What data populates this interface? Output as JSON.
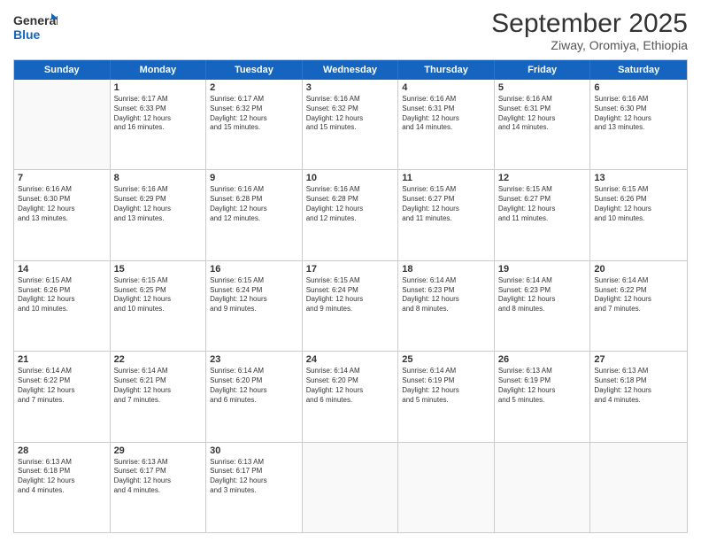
{
  "header": {
    "logo_line1": "General",
    "logo_line2": "Blue",
    "title": "September 2025",
    "subtitle": "Ziway, Oromiya, Ethiopia"
  },
  "calendar": {
    "headers": [
      "Sunday",
      "Monday",
      "Tuesday",
      "Wednesday",
      "Thursday",
      "Friday",
      "Saturday"
    ],
    "rows": [
      [
        {
          "day": "",
          "empty": true,
          "lines": []
        },
        {
          "day": "1",
          "lines": [
            "Sunrise: 6:17 AM",
            "Sunset: 6:33 PM",
            "Daylight: 12 hours",
            "and 16 minutes."
          ]
        },
        {
          "day": "2",
          "lines": [
            "Sunrise: 6:17 AM",
            "Sunset: 6:32 PM",
            "Daylight: 12 hours",
            "and 15 minutes."
          ]
        },
        {
          "day": "3",
          "lines": [
            "Sunrise: 6:16 AM",
            "Sunset: 6:32 PM",
            "Daylight: 12 hours",
            "and 15 minutes."
          ]
        },
        {
          "day": "4",
          "lines": [
            "Sunrise: 6:16 AM",
            "Sunset: 6:31 PM",
            "Daylight: 12 hours",
            "and 14 minutes."
          ]
        },
        {
          "day": "5",
          "lines": [
            "Sunrise: 6:16 AM",
            "Sunset: 6:31 PM",
            "Daylight: 12 hours",
            "and 14 minutes."
          ]
        },
        {
          "day": "6",
          "lines": [
            "Sunrise: 6:16 AM",
            "Sunset: 6:30 PM",
            "Daylight: 12 hours",
            "and 13 minutes."
          ]
        }
      ],
      [
        {
          "day": "7",
          "lines": [
            "Sunrise: 6:16 AM",
            "Sunset: 6:30 PM",
            "Daylight: 12 hours",
            "and 13 minutes."
          ]
        },
        {
          "day": "8",
          "lines": [
            "Sunrise: 6:16 AM",
            "Sunset: 6:29 PM",
            "Daylight: 12 hours",
            "and 13 minutes."
          ]
        },
        {
          "day": "9",
          "lines": [
            "Sunrise: 6:16 AM",
            "Sunset: 6:28 PM",
            "Daylight: 12 hours",
            "and 12 minutes."
          ]
        },
        {
          "day": "10",
          "lines": [
            "Sunrise: 6:16 AM",
            "Sunset: 6:28 PM",
            "Daylight: 12 hours",
            "and 12 minutes."
          ]
        },
        {
          "day": "11",
          "lines": [
            "Sunrise: 6:15 AM",
            "Sunset: 6:27 PM",
            "Daylight: 12 hours",
            "and 11 minutes."
          ]
        },
        {
          "day": "12",
          "lines": [
            "Sunrise: 6:15 AM",
            "Sunset: 6:27 PM",
            "Daylight: 12 hours",
            "and 11 minutes."
          ]
        },
        {
          "day": "13",
          "lines": [
            "Sunrise: 6:15 AM",
            "Sunset: 6:26 PM",
            "Daylight: 12 hours",
            "and 10 minutes."
          ]
        }
      ],
      [
        {
          "day": "14",
          "lines": [
            "Sunrise: 6:15 AM",
            "Sunset: 6:26 PM",
            "Daylight: 12 hours",
            "and 10 minutes."
          ]
        },
        {
          "day": "15",
          "lines": [
            "Sunrise: 6:15 AM",
            "Sunset: 6:25 PM",
            "Daylight: 12 hours",
            "and 10 minutes."
          ]
        },
        {
          "day": "16",
          "lines": [
            "Sunrise: 6:15 AM",
            "Sunset: 6:24 PM",
            "Daylight: 12 hours",
            "and 9 minutes."
          ]
        },
        {
          "day": "17",
          "lines": [
            "Sunrise: 6:15 AM",
            "Sunset: 6:24 PM",
            "Daylight: 12 hours",
            "and 9 minutes."
          ]
        },
        {
          "day": "18",
          "lines": [
            "Sunrise: 6:14 AM",
            "Sunset: 6:23 PM",
            "Daylight: 12 hours",
            "and 8 minutes."
          ]
        },
        {
          "day": "19",
          "lines": [
            "Sunrise: 6:14 AM",
            "Sunset: 6:23 PM",
            "Daylight: 12 hours",
            "and 8 minutes."
          ]
        },
        {
          "day": "20",
          "lines": [
            "Sunrise: 6:14 AM",
            "Sunset: 6:22 PM",
            "Daylight: 12 hours",
            "and 7 minutes."
          ]
        }
      ],
      [
        {
          "day": "21",
          "lines": [
            "Sunrise: 6:14 AM",
            "Sunset: 6:22 PM",
            "Daylight: 12 hours",
            "and 7 minutes."
          ]
        },
        {
          "day": "22",
          "lines": [
            "Sunrise: 6:14 AM",
            "Sunset: 6:21 PM",
            "Daylight: 12 hours",
            "and 7 minutes."
          ]
        },
        {
          "day": "23",
          "lines": [
            "Sunrise: 6:14 AM",
            "Sunset: 6:20 PM",
            "Daylight: 12 hours",
            "and 6 minutes."
          ]
        },
        {
          "day": "24",
          "lines": [
            "Sunrise: 6:14 AM",
            "Sunset: 6:20 PM",
            "Daylight: 12 hours",
            "and 6 minutes."
          ]
        },
        {
          "day": "25",
          "lines": [
            "Sunrise: 6:14 AM",
            "Sunset: 6:19 PM",
            "Daylight: 12 hours",
            "and 5 minutes."
          ]
        },
        {
          "day": "26",
          "lines": [
            "Sunrise: 6:13 AM",
            "Sunset: 6:19 PM",
            "Daylight: 12 hours",
            "and 5 minutes."
          ]
        },
        {
          "day": "27",
          "lines": [
            "Sunrise: 6:13 AM",
            "Sunset: 6:18 PM",
            "Daylight: 12 hours",
            "and 4 minutes."
          ]
        }
      ],
      [
        {
          "day": "28",
          "lines": [
            "Sunrise: 6:13 AM",
            "Sunset: 6:18 PM",
            "Daylight: 12 hours",
            "and 4 minutes."
          ]
        },
        {
          "day": "29",
          "lines": [
            "Sunrise: 6:13 AM",
            "Sunset: 6:17 PM",
            "Daylight: 12 hours",
            "and 4 minutes."
          ]
        },
        {
          "day": "30",
          "lines": [
            "Sunrise: 6:13 AM",
            "Sunset: 6:17 PM",
            "Daylight: 12 hours",
            "and 3 minutes."
          ]
        },
        {
          "day": "",
          "empty": true,
          "lines": []
        },
        {
          "day": "",
          "empty": true,
          "lines": []
        },
        {
          "day": "",
          "empty": true,
          "lines": []
        },
        {
          "day": "",
          "empty": true,
          "lines": []
        }
      ]
    ]
  }
}
